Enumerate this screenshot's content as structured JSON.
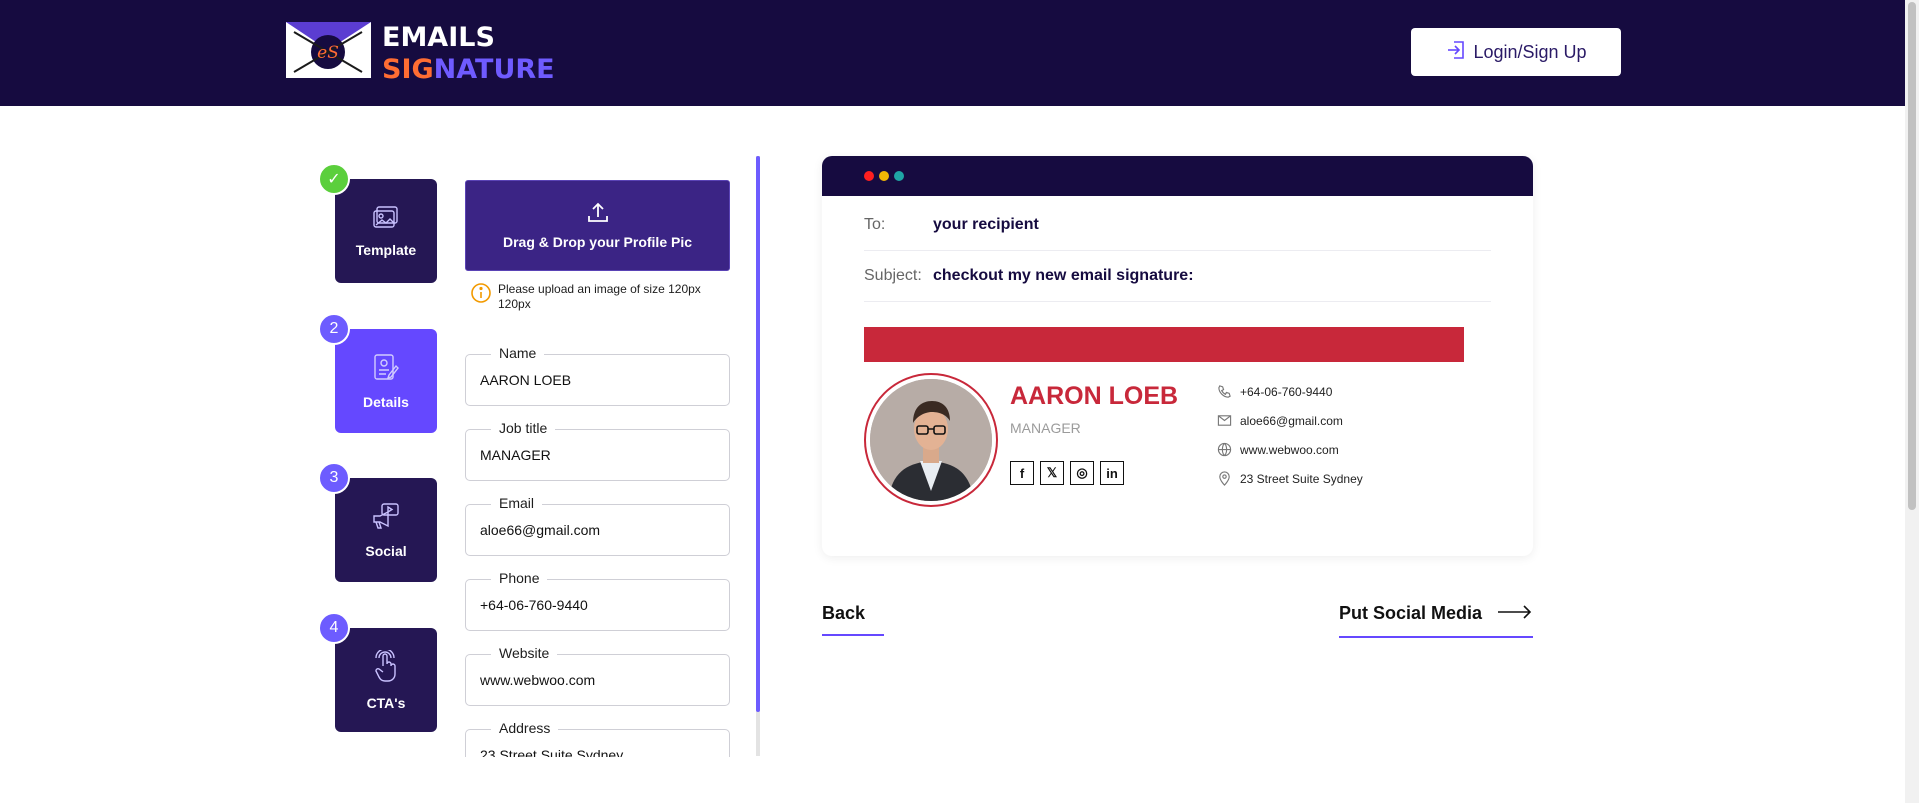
{
  "brand": {
    "line1": "EMAILS",
    "line2_part1": "SIG",
    "line2_part2": "NATURE",
    "logo_mark": "eS"
  },
  "header": {
    "login_label": "Login/Sign Up"
  },
  "steps": [
    {
      "label": "Template",
      "badge": "✓",
      "state": "done"
    },
    {
      "label": "Details",
      "badge": "2",
      "state": "active"
    },
    {
      "label": "Social",
      "badge": "3",
      "state": "pending"
    },
    {
      "label": "CTA's",
      "badge": "4",
      "state": "pending"
    }
  ],
  "upload": {
    "button_label": "Drag & Drop your Profile Pic",
    "note": "Please upload an image of size 120px 120px"
  },
  "form": {
    "name_label": "Name",
    "name_value": "AARON LOEB",
    "job_label": "Job title",
    "job_value": "MANAGER",
    "email_label": "Email",
    "email_value": "aloe66@gmail.com",
    "phone_label": "Phone",
    "phone_value": "+64-06-760-9440",
    "website_label": "Website",
    "website_value": "www.webwoo.com",
    "address_label": "Address",
    "address_value": "23 Street Suite Sydney"
  },
  "preview": {
    "to_label": "To:",
    "to_value": "your recipient",
    "subject_label": "Subject:",
    "subject_value": "checkout my new email signature:",
    "dots": [
      "#ff1f1f",
      "#f2b705",
      "#1fa5a5"
    ]
  },
  "signature": {
    "name": "AARON LOEB",
    "title": "MANAGER",
    "accent_color": "#c8283a",
    "social": [
      "f",
      "𝕏",
      "◎",
      "in"
    ],
    "phone": "+64-06-760-9440",
    "email": "aloe66@gmail.com",
    "website": "www.webwoo.com",
    "address": "23 Street Suite Sydney"
  },
  "nav": {
    "back_label": "Back",
    "next_label": "Put Social Media"
  }
}
